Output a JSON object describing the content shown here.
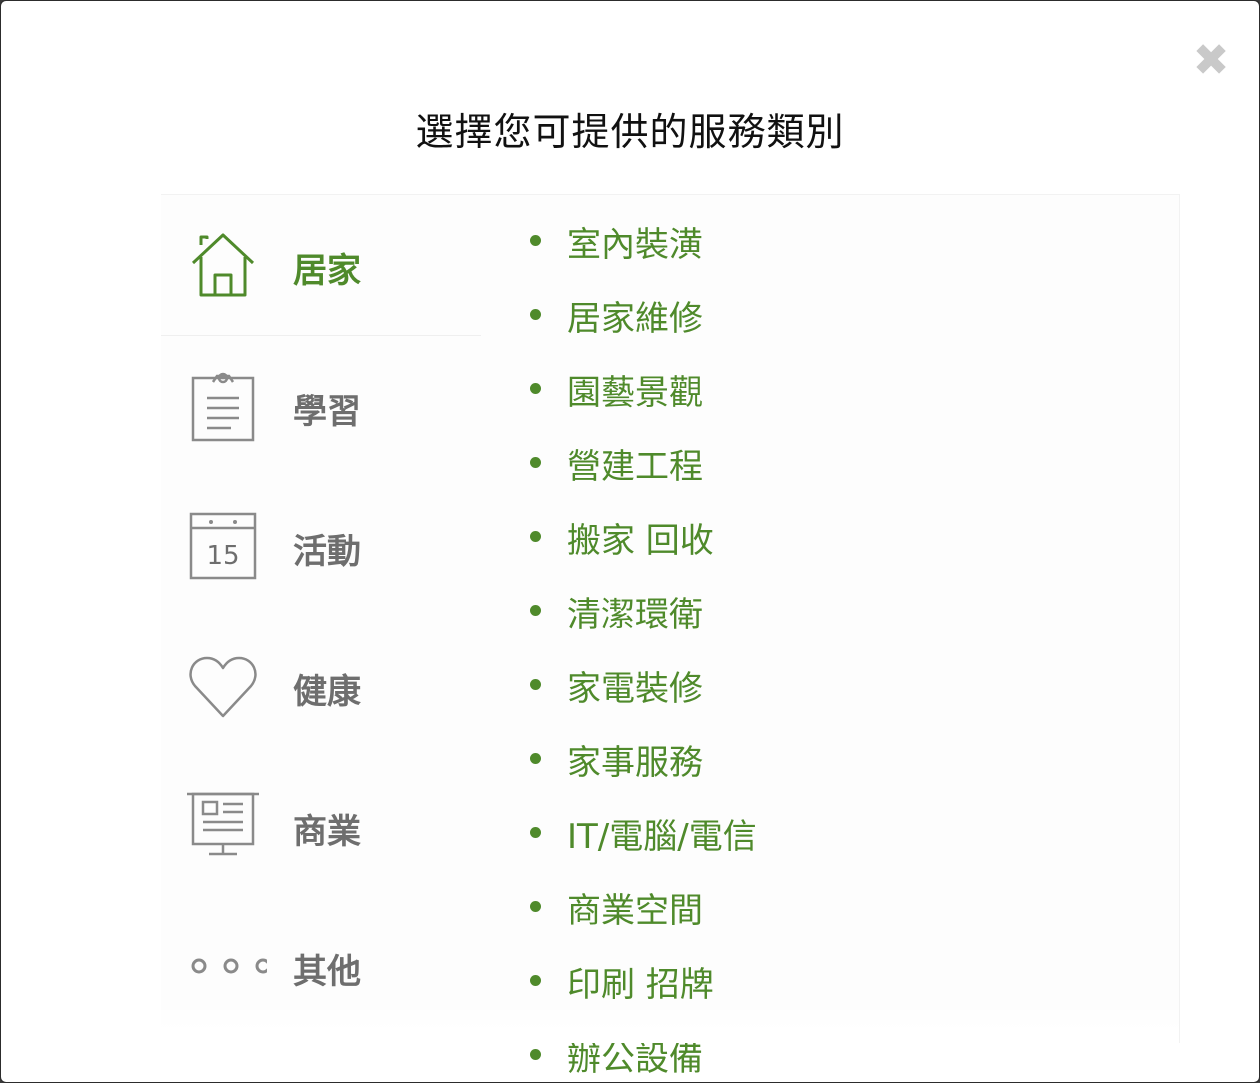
{
  "dialog": {
    "title": "選擇您可提供的服務類別",
    "close_icon": "close-icon"
  },
  "colors": {
    "accent": "#4f8a2b",
    "inactive": "#6e6e6e"
  },
  "categories": [
    {
      "label": "居家",
      "icon": "house-icon",
      "active": true
    },
    {
      "label": "學習",
      "icon": "clipboard-icon",
      "active": false
    },
    {
      "label": "活動",
      "icon": "calendar-icon",
      "active": false,
      "icon_text": "15"
    },
    {
      "label": "健康",
      "icon": "heart-icon",
      "active": false
    },
    {
      "label": "商業",
      "icon": "presentation-board-icon",
      "active": false
    },
    {
      "label": "其他",
      "icon": "more-dots-icon",
      "active": false
    }
  ],
  "subcategories": [
    "室內裝潢",
    "居家維修",
    "園藝景觀",
    "營建工程",
    "搬家 回收",
    "清潔環衛",
    "家電裝修",
    "家事服務",
    "IT/電腦/電信",
    "商業空間",
    "印刷 招牌",
    "辦公設備"
  ]
}
